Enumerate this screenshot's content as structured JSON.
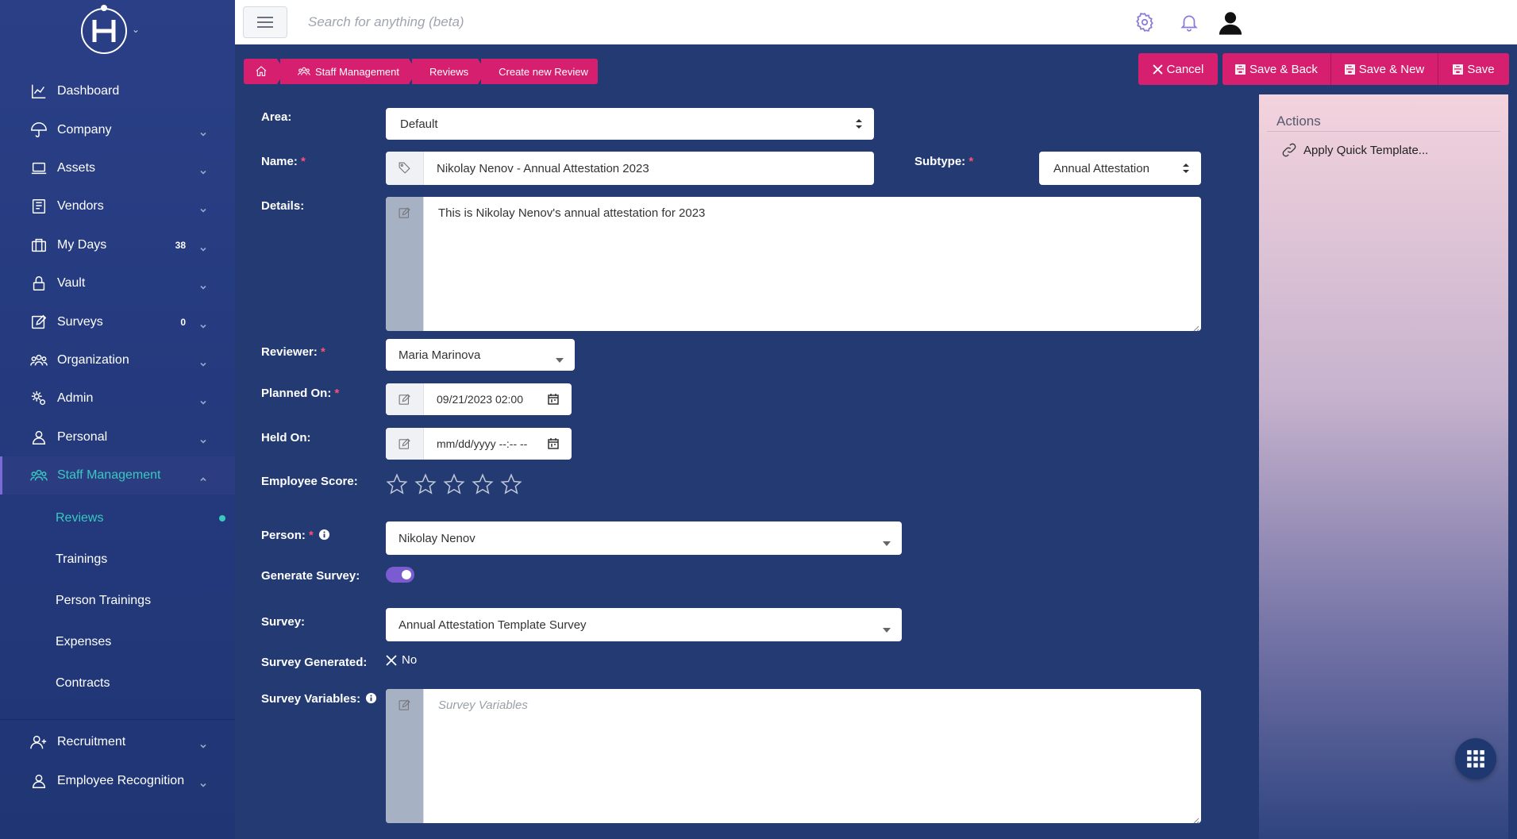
{
  "search": {
    "placeholder": "Search for anything (beta)"
  },
  "sidebar": {
    "items": [
      {
        "label": "Dashboard"
      },
      {
        "label": "Company"
      },
      {
        "label": "Assets"
      },
      {
        "label": "Vendors"
      },
      {
        "label": "My Days",
        "badge": "38"
      },
      {
        "label": "Vault"
      },
      {
        "label": "Surveys",
        "badge": "0"
      },
      {
        "label": "Organization"
      },
      {
        "label": "Admin"
      },
      {
        "label": "Personal"
      },
      {
        "label": "Staff Management"
      }
    ],
    "sub_items": [
      {
        "label": "Reviews"
      },
      {
        "label": "Trainings"
      },
      {
        "label": "Person Trainings"
      },
      {
        "label": "Expenses"
      },
      {
        "label": "Contracts"
      }
    ],
    "bottom_items": [
      {
        "label": "Recruitment"
      },
      {
        "label": "Employee Recognition"
      }
    ]
  },
  "breadcrumb": {
    "staff": "Staff Management",
    "reviews": "Reviews",
    "current": "Create new Review"
  },
  "actions": {
    "cancel": "Cancel",
    "save_back": "Save & Back",
    "save_new": "Save & New",
    "save": "Save"
  },
  "form": {
    "area_label": "Area:",
    "area_value": "Default",
    "name_label": "Name:",
    "name_value": "Nikolay Nenov - Annual Attestation 2023",
    "subtype_label": "Subtype:",
    "subtype_value": "Annual Attestation",
    "details_label": "Details:",
    "details_value": "This is Nikolay Nenov's annual attestation for 2023",
    "reviewer_label": "Reviewer:",
    "reviewer_value": "Maria Marinova",
    "planned_label": "Planned On:",
    "planned_value": "09/21/2023 02:00",
    "held_label": "Held On:",
    "held_value": "mm/dd/yyyy --:-- --",
    "score_label": "Employee Score:",
    "score_value": 0,
    "score_max": 5,
    "person_label": "Person:",
    "person_value": "Nikolay Nenov",
    "generate_label": "Generate Survey:",
    "generate_on": true,
    "survey_label": "Survey:",
    "survey_value": "Annual Attestation Template Survey",
    "generated_label": "Survey Generated:",
    "generated_value": "No",
    "variables_label": "Survey Variables:",
    "variables_placeholder": "Survey Variables",
    "required_mark": "*"
  },
  "panel": {
    "title": "Actions",
    "apply_template": "Apply Quick Template..."
  },
  "colors": {
    "accent": "#d61f6f",
    "teal": "#38c9c0",
    "purple": "#7b5cd0",
    "bg": "#233a73"
  }
}
